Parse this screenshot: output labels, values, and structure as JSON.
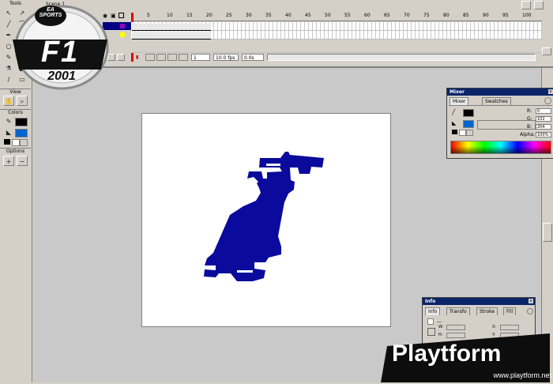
{
  "tools": {
    "title": "Tools",
    "view_label": "View",
    "colors_label": "Colors",
    "options_label": "Options",
    "icons": [
      "arrow-icon",
      "subselect-icon",
      "line-icon",
      "lasso-icon",
      "pen-icon",
      "text-icon",
      "oval-icon",
      "rectangle-icon",
      "pencil-icon",
      "brush-icon",
      "inkbottle-icon",
      "paintbucket-icon",
      "eyedropper-icon",
      "eraser-icon",
      "hand-icon",
      "zoom-icon"
    ]
  },
  "timeline": {
    "scene_tab": "Scene 1",
    "ruler_ticks": [
      "1",
      "5",
      "10",
      "15",
      "20",
      "25",
      "30",
      "35",
      "40",
      "45",
      "50",
      "55",
      "60",
      "65",
      "70",
      "75",
      "80",
      "85",
      "90",
      "95",
      "100"
    ],
    "frame_field": "1",
    "fps_field": "10.0 fps",
    "time_field": "0.0s"
  },
  "mixer": {
    "title": "Mixer",
    "tabs": [
      "Mixer",
      "Swatches"
    ],
    "r_label": "R:",
    "r_value": "0",
    "g_label": "G:",
    "g_value": "102",
    "b_label": "B:",
    "b_value": "204",
    "alpha_label": "Alpha:",
    "alpha_value": "100%"
  },
  "info": {
    "title": "Info",
    "tabs": [
      "Info",
      "Transfo",
      "Stroke",
      "Fill"
    ],
    "w_label": "W:",
    "h_label": "H:",
    "x_label": "X:",
    "y_label": "Y:"
  },
  "logos": {
    "ea_sports": "EA SPORTS",
    "f1": "F1",
    "year": "2001",
    "watermark_brand": "Playtform",
    "watermark_url": "www.playtform.net"
  },
  "colors": {
    "car_fill": "#0a0a9c",
    "panel_title": "#0a246a"
  }
}
